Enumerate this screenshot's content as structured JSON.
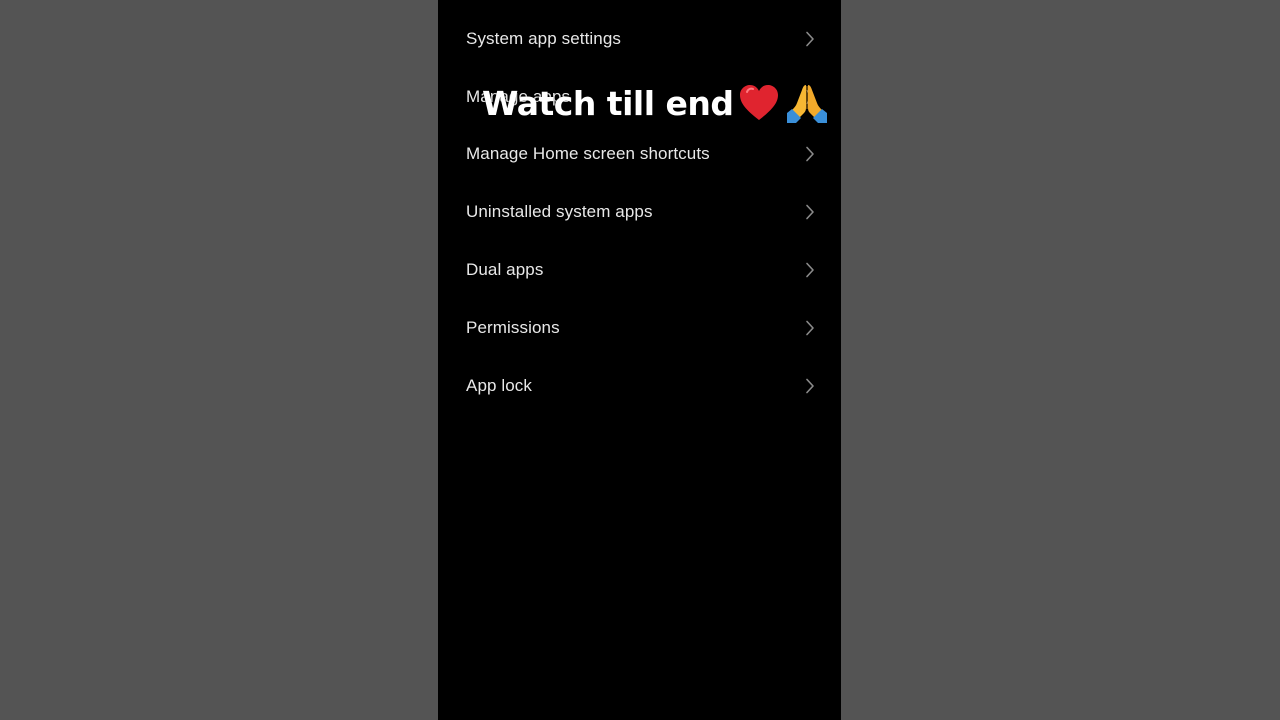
{
  "menu": {
    "items": [
      {
        "label": "System app settings"
      },
      {
        "label": "Manage apps"
      },
      {
        "label": "Manage Home screen shortcuts"
      },
      {
        "label": "Uninstalled system apps"
      },
      {
        "label": "Dual apps"
      },
      {
        "label": "Permissions"
      },
      {
        "label": "App lock"
      }
    ],
    "chevron_icon": "chevron-right-icon"
  },
  "overlay": {
    "caption": "Watch till end",
    "icons": [
      "heart-icon",
      "praying-hands-icon"
    ],
    "heart_color": "#e0242f",
    "hands_color": "#f7b733",
    "sleeve_color": "#3a8fd9"
  },
  "colors": {
    "outer_background": "#545454",
    "screen_background": "#000000",
    "label_color": "#e8e8e8",
    "chevron_color": "#8a8a8a"
  }
}
